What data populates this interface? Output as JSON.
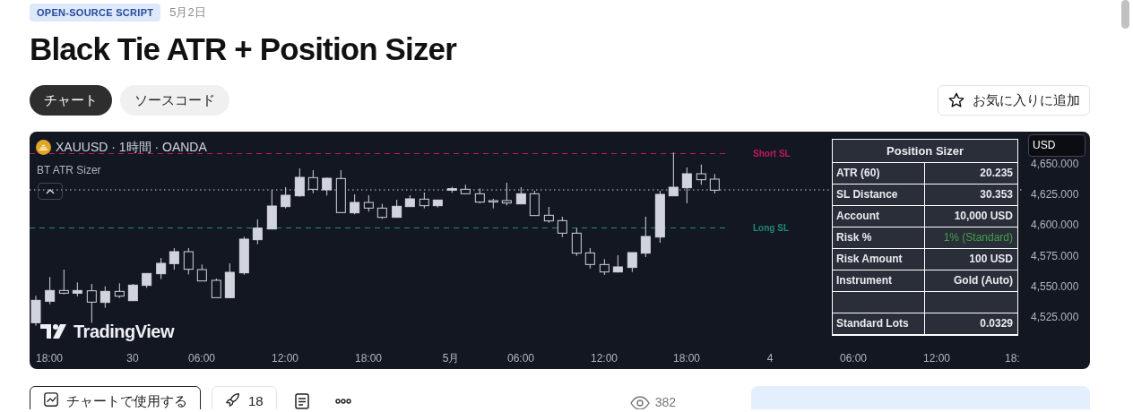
{
  "badge": "OPEN-SOURCE SCRIPT",
  "date": "5月2日",
  "title": "Black Tie ATR + Position Sizer",
  "tabs": [
    {
      "label": "チャート",
      "selected": true
    },
    {
      "label": "ソースコード",
      "selected": false
    }
  ],
  "favorite_button": "お気に入りに追加",
  "chart": {
    "symbol": "XAUUSD · 1時間 · OANDA",
    "indicator": "BT ATR Sizer",
    "logo": "TradingView",
    "currency": "USD",
    "levels": [
      {
        "label": "Short SL",
        "color": "#c2185b"
      },
      {
        "label": "Long SL",
        "color": "#1e8a77"
      }
    ],
    "price_labels": [
      "4,650.000",
      "4,625.000",
      "4,600.000",
      "4,575.000",
      "4,550.000",
      "4,525.000"
    ],
    "time_labels": [
      "18:00",
      "30",
      "06:00",
      "12:00",
      "18:00",
      "5月",
      "06:00",
      "12:00",
      "18:00",
      "4",
      "06:00",
      "12:00",
      "18:"
    ],
    "table": {
      "title": "Position Sizer",
      "rows": [
        {
          "kind": "data",
          "label": "ATR (60)",
          "value": "20.235",
          "highlight": false
        },
        {
          "kind": "data",
          "label": "SL Distance",
          "value": "30.353",
          "highlight": false
        },
        {
          "kind": "data",
          "label": "Account",
          "value": "10,000 USD",
          "highlight": false
        },
        {
          "kind": "data",
          "label": "Risk %",
          "value": "1%  (Standard)",
          "highlight": true
        },
        {
          "kind": "data",
          "label": "Risk Amount",
          "value": "100 USD",
          "highlight": false
        },
        {
          "kind": "data",
          "label": "Instrument",
          "value": "Gold  (Auto)",
          "highlight": false
        },
        {
          "kind": "blank"
        },
        {
          "kind": "data",
          "label": "Standard Lots",
          "value": "0.0329",
          "highlight": false
        }
      ]
    }
  },
  "actions": {
    "use_button": "チャートで使用する",
    "boost_count": "18",
    "views": "382"
  }
}
